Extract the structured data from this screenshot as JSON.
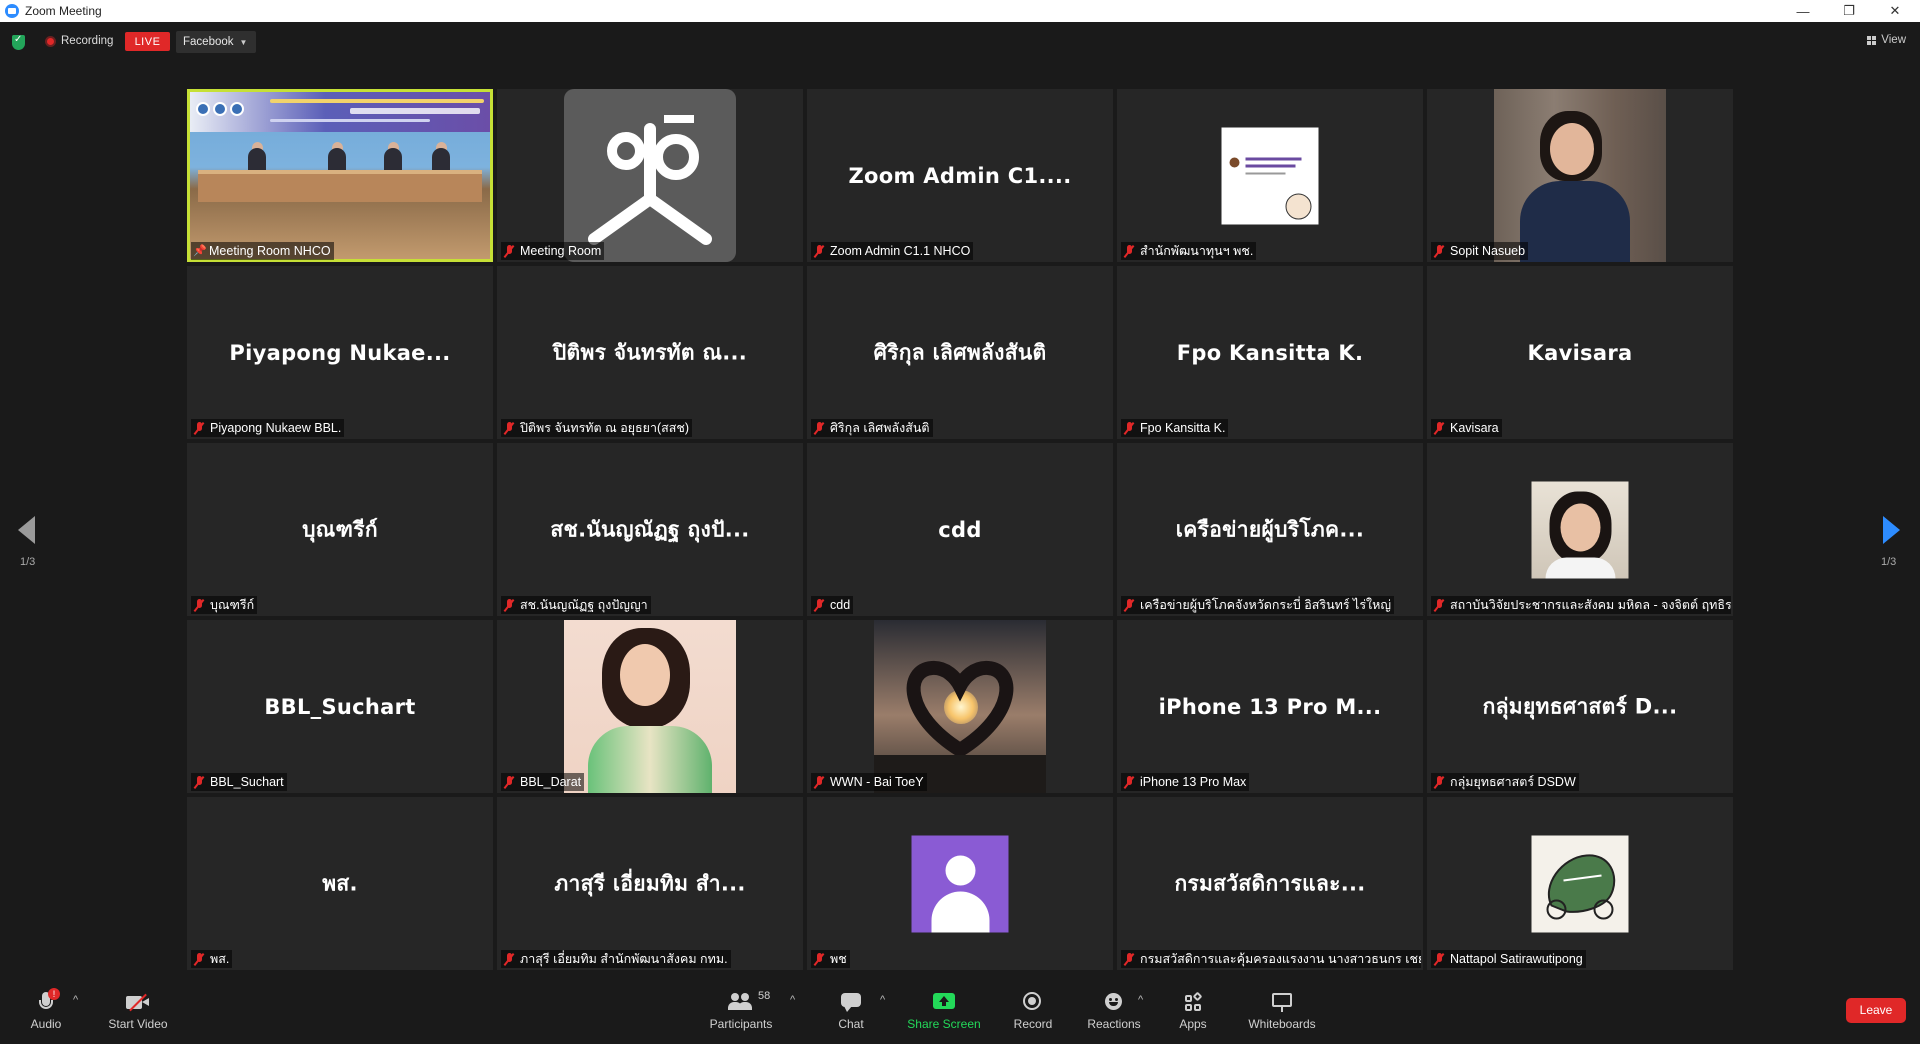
{
  "window": {
    "title": "Zoom Meeting",
    "minimize": "—",
    "restore": "❐",
    "close": "✕"
  },
  "topbar": {
    "recording_label": "Recording",
    "live_label": "LIVE",
    "stream_target": "Facebook",
    "view_label": "View"
  },
  "pager": {
    "left_page": "1/3",
    "right_page": "1/3"
  },
  "tiles": [
    {
      "label": "Meeting Room NHCO",
      "big": "",
      "kind": "meeting"
    },
    {
      "label": "Meeting Room",
      "big": "",
      "kind": "logo"
    },
    {
      "label": "Zoom Admin C1.1 NHCO",
      "big": "Zoom Admin C1....",
      "kind": "name"
    },
    {
      "label": "สำนักพัฒนาทุนฯ พช.",
      "big": "",
      "kind": "doc"
    },
    {
      "label": "Sopit Nasueb",
      "big": "",
      "kind": "photo-woman"
    },
    {
      "label": "Piyapong Nukaew BBL.",
      "big": "Piyapong  Nukae...",
      "kind": "name"
    },
    {
      "label": "ปิติพร จันทรทัต ณ อยุธยา(สสช)",
      "big": "ปิติพร จันทรทัต ณ...",
      "kind": "name"
    },
    {
      "label": "ศิริกุล เลิศพลังสันติ",
      "big": "ศิริกุล เลิศพลังสันติ",
      "kind": "name"
    },
    {
      "label": "Fpo Kansitta K.",
      "big": "Fpo Kansitta K.",
      "kind": "name"
    },
    {
      "label": "Kavisara",
      "big": "Kavisara",
      "kind": "name"
    },
    {
      "label": "บุณฑรีก์",
      "big": "บุณฑรีก์",
      "kind": "name"
    },
    {
      "label": "สช.นันญณัฏฐ ถุงปัญญา",
      "big": "สช.นันญณัฏฐ ถุงปั...",
      "kind": "name"
    },
    {
      "label": "cdd",
      "big": "cdd",
      "kind": "name"
    },
    {
      "label": "เครือข่ายผู้บริโภคจังหวัดกระบี่ อิสรินทร์ ไร่ใหญ่",
      "big": "เครือข่ายผู้บริโภค...",
      "kind": "name"
    },
    {
      "label": "สถาบันวิจัยประชากรและสังคม มหิดล - จงจิตต์ ฤทธิรงค์",
      "big": "",
      "kind": "small-woman"
    },
    {
      "label": "BBL_Suchart",
      "big": "BBL_Suchart",
      "kind": "name"
    },
    {
      "label": "BBL_Darat",
      "big": "",
      "kind": "photo-darat"
    },
    {
      "label": "WWN - Bai ToeY",
      "big": "",
      "kind": "heart"
    },
    {
      "label": "iPhone 13 Pro Max",
      "big": "iPhone 13 Pro M...",
      "kind": "name"
    },
    {
      "label": "กลุ่มยุทธศาสตร์ DSDW",
      "big": "กลุ่มยุทธศาสตร์ D...",
      "kind": "name"
    },
    {
      "label": "พส.",
      "big": "พส.",
      "kind": "name"
    },
    {
      "label": "ภาสุรี เอี่ยมทิม สำนักพัฒนาสังคม กทม.",
      "big": "ภาสุรี เอี่ยมทิม สำ...",
      "kind": "name"
    },
    {
      "label": "พช",
      "big": "",
      "kind": "avatar"
    },
    {
      "label": "กรมสวัสดิการและคุ้มครองแรงงาน นางสาวธนกร เชยสิทธิ์",
      "big": "กรมสวัสดิการและ...",
      "kind": "name"
    },
    {
      "label": "Nattapol Satirawutipong",
      "big": "",
      "kind": "bike"
    }
  ],
  "toolbar": {
    "audio": "Audio",
    "audio_badge": "!",
    "start_video": "Start Video",
    "participants": "Participants",
    "participants_count": "58",
    "chat": "Chat",
    "share_screen": "Share Screen",
    "record": "Record",
    "reactions": "Reactions",
    "apps": "Apps",
    "whiteboards": "Whiteboards",
    "leave": "Leave"
  },
  "colors": {
    "share_green": "#23d959",
    "leave_red": "#e02828",
    "active_border": "#c6e036"
  }
}
